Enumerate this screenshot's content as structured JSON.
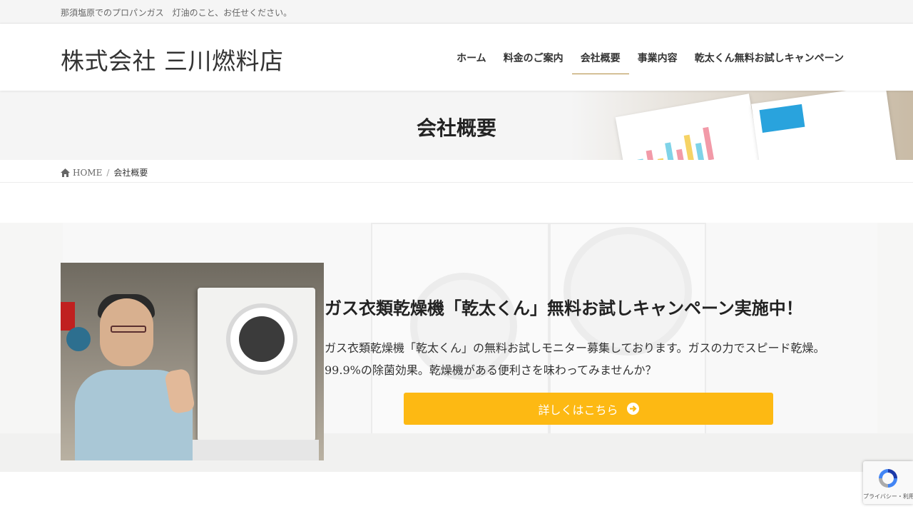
{
  "topbar": {
    "tagline": "那須塩原でのプロパンガス　灯油のこと、お任せください。"
  },
  "header": {
    "logo": "株式会社 三川燃料店",
    "nav": [
      {
        "label": "ホーム",
        "active": false
      },
      {
        "label": "料金のご案内",
        "active": false
      },
      {
        "label": "会社概要",
        "active": true
      },
      {
        "label": "事業内容",
        "active": false
      },
      {
        "label": "乾太くん無料お試しキャンペーン",
        "active": false
      }
    ]
  },
  "page_header": {
    "title": "会社概要"
  },
  "breadcrumb": {
    "home": "HOME",
    "separator": "/",
    "current": "会社概要"
  },
  "campaign": {
    "title": "ガス衣類乾燥機「乾太くん」無料お試しキャンペーン実施中！",
    "text": "ガス衣類乾燥機「乾太くん」の無料お試しモニター募集しております。ガスの力でスピード乾燥。99.9%の除菌効果。乾燥機がある便利さを味わってみませんか？",
    "button_label": "詳しくはこちら",
    "button_icon": "arrow-circle-right-icon",
    "button_color": "#fdb913"
  },
  "recaptcha": {
    "terms": "プライバシー・利用規約"
  },
  "colors": {
    "nav_active_underline": "#b08a3e",
    "accent": "#fdb913"
  }
}
